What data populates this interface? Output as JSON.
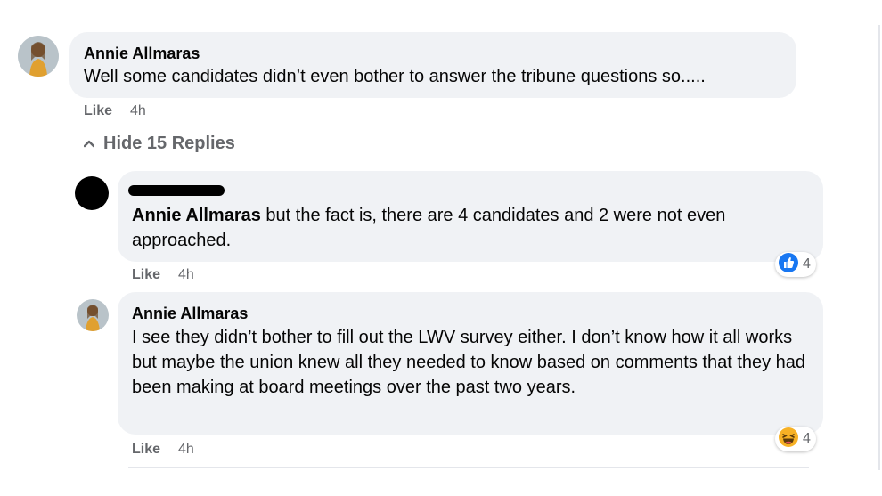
{
  "comment": {
    "author": "Annie Allmaras",
    "text": "Well some candidates didn’t even bother to answer the tribune questions so.....",
    "like_label": "Like",
    "time": "4h"
  },
  "replies_toggle": {
    "label": "Hide 15 Replies",
    "icon": "chevron-up-icon"
  },
  "replies": [
    {
      "author": "",
      "mention": "Annie Allmaras",
      "text": " but the fact is, there are 4 candidates and 2 were not even approached.",
      "like_label": "Like",
      "time": "4h",
      "reaction_icon": "like-reaction-icon",
      "reaction_count": "4"
    },
    {
      "author": "Annie Allmaras",
      "text": "I see they didn’t bother to fill out the LWV survey either. I don’t know how it all works but maybe the union knew all they needed to know based on comments that they had been making at board meetings over the past two years.",
      "like_label": "Like",
      "time": "4h",
      "reaction_icon": "haha-reaction-icon",
      "reaction_count": "4"
    }
  ],
  "colors": {
    "bubble": "#f0f2f5",
    "meta_text": "#65676b",
    "like_blue": "#1877f2",
    "haha_yellow": "#f7b125"
  }
}
